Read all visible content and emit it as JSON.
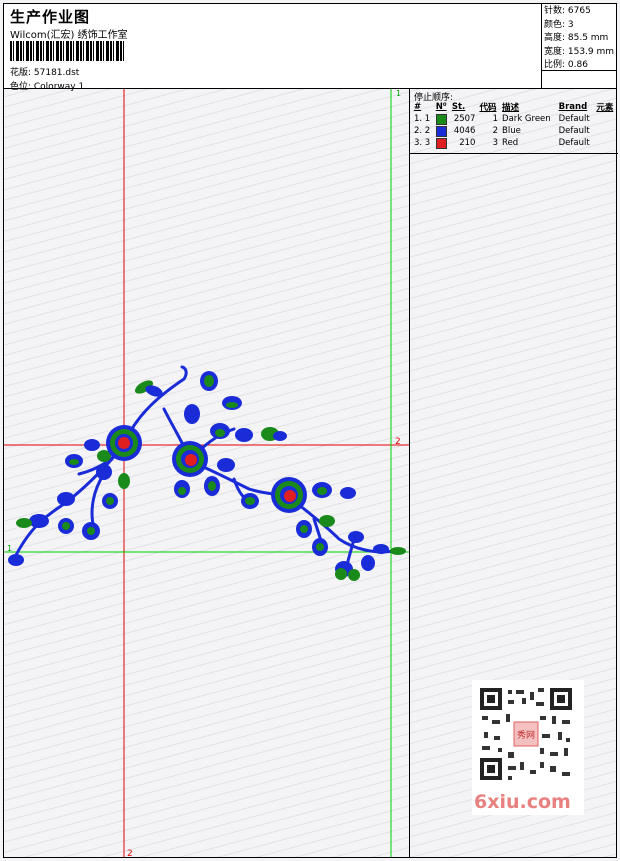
{
  "header": {
    "title": "生产作业图",
    "company": "Wilcom(汇宏) 绣饰工作室",
    "design_label": "花版: 57181.dst",
    "colorway_label": "色位: Colorway 1"
  },
  "stats": {
    "stitches": "针数: 6765",
    "colors": "颜色: 3",
    "height": "高度: 85.5 mm",
    "width": "宽度: 153.9 mm",
    "scale": "比例: 0.86"
  },
  "stop_sequence": {
    "title": "停止顺序:",
    "columns": [
      "#",
      "N⁰",
      "St.",
      "代码",
      "描述",
      "Brand",
      "元素"
    ],
    "rows": [
      {
        "seq": "1. 1",
        "color": "#1a8a1a",
        "number": "2507",
        "code": "1",
        "description": "Dark Green",
        "brand": "Default"
      },
      {
        "seq": "2. 2",
        "color": "#1a2bd8",
        "number": "4046",
        "code": "2",
        "description": "Blue",
        "brand": "Default"
      },
      {
        "seq": "3. 3",
        "color": "#e02020",
        "number": "210",
        "code": "3",
        "description": "Red",
        "brand": "Default"
      }
    ]
  },
  "guides": {
    "green_top_label": "1",
    "green_left_label": "1",
    "red_right_label": "2",
    "red_bottom_label": "2"
  },
  "watermark": {
    "text": "6xiu.com",
    "stamp": "秀网"
  },
  "colors": {
    "green": "#1a8a1a",
    "blue": "#1a2bd8",
    "red": "#e02020",
    "guide_red": "#e00000",
    "guide_green": "#00d000"
  }
}
